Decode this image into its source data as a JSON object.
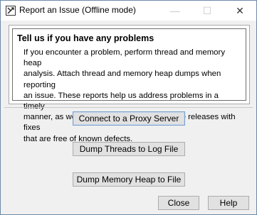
{
  "window": {
    "title": "Report an Issue (Offline mode)",
    "icons": [
      "app-icon",
      "minimize-icon",
      "maximize-icon",
      "close-icon"
    ]
  },
  "panel": {
    "title": "Tell us if you have any problems",
    "lines": [
      "If you encounter a problem, perform thread and memory heap",
      "analysis. Attach thread and memory heap dumps when reporting",
      "an issue. These reports help us address problems in a timely",
      "manner, as well as speeding up maintenance releases with fixes",
      "that are free of known defects."
    ]
  },
  "actions": {
    "proxy": "Connect to a Proxy Server",
    "threads": "Dump Threads to Log File",
    "heap": "Dump Memory Heap to File"
  },
  "footer": {
    "close": "Close",
    "help": "Help"
  }
}
